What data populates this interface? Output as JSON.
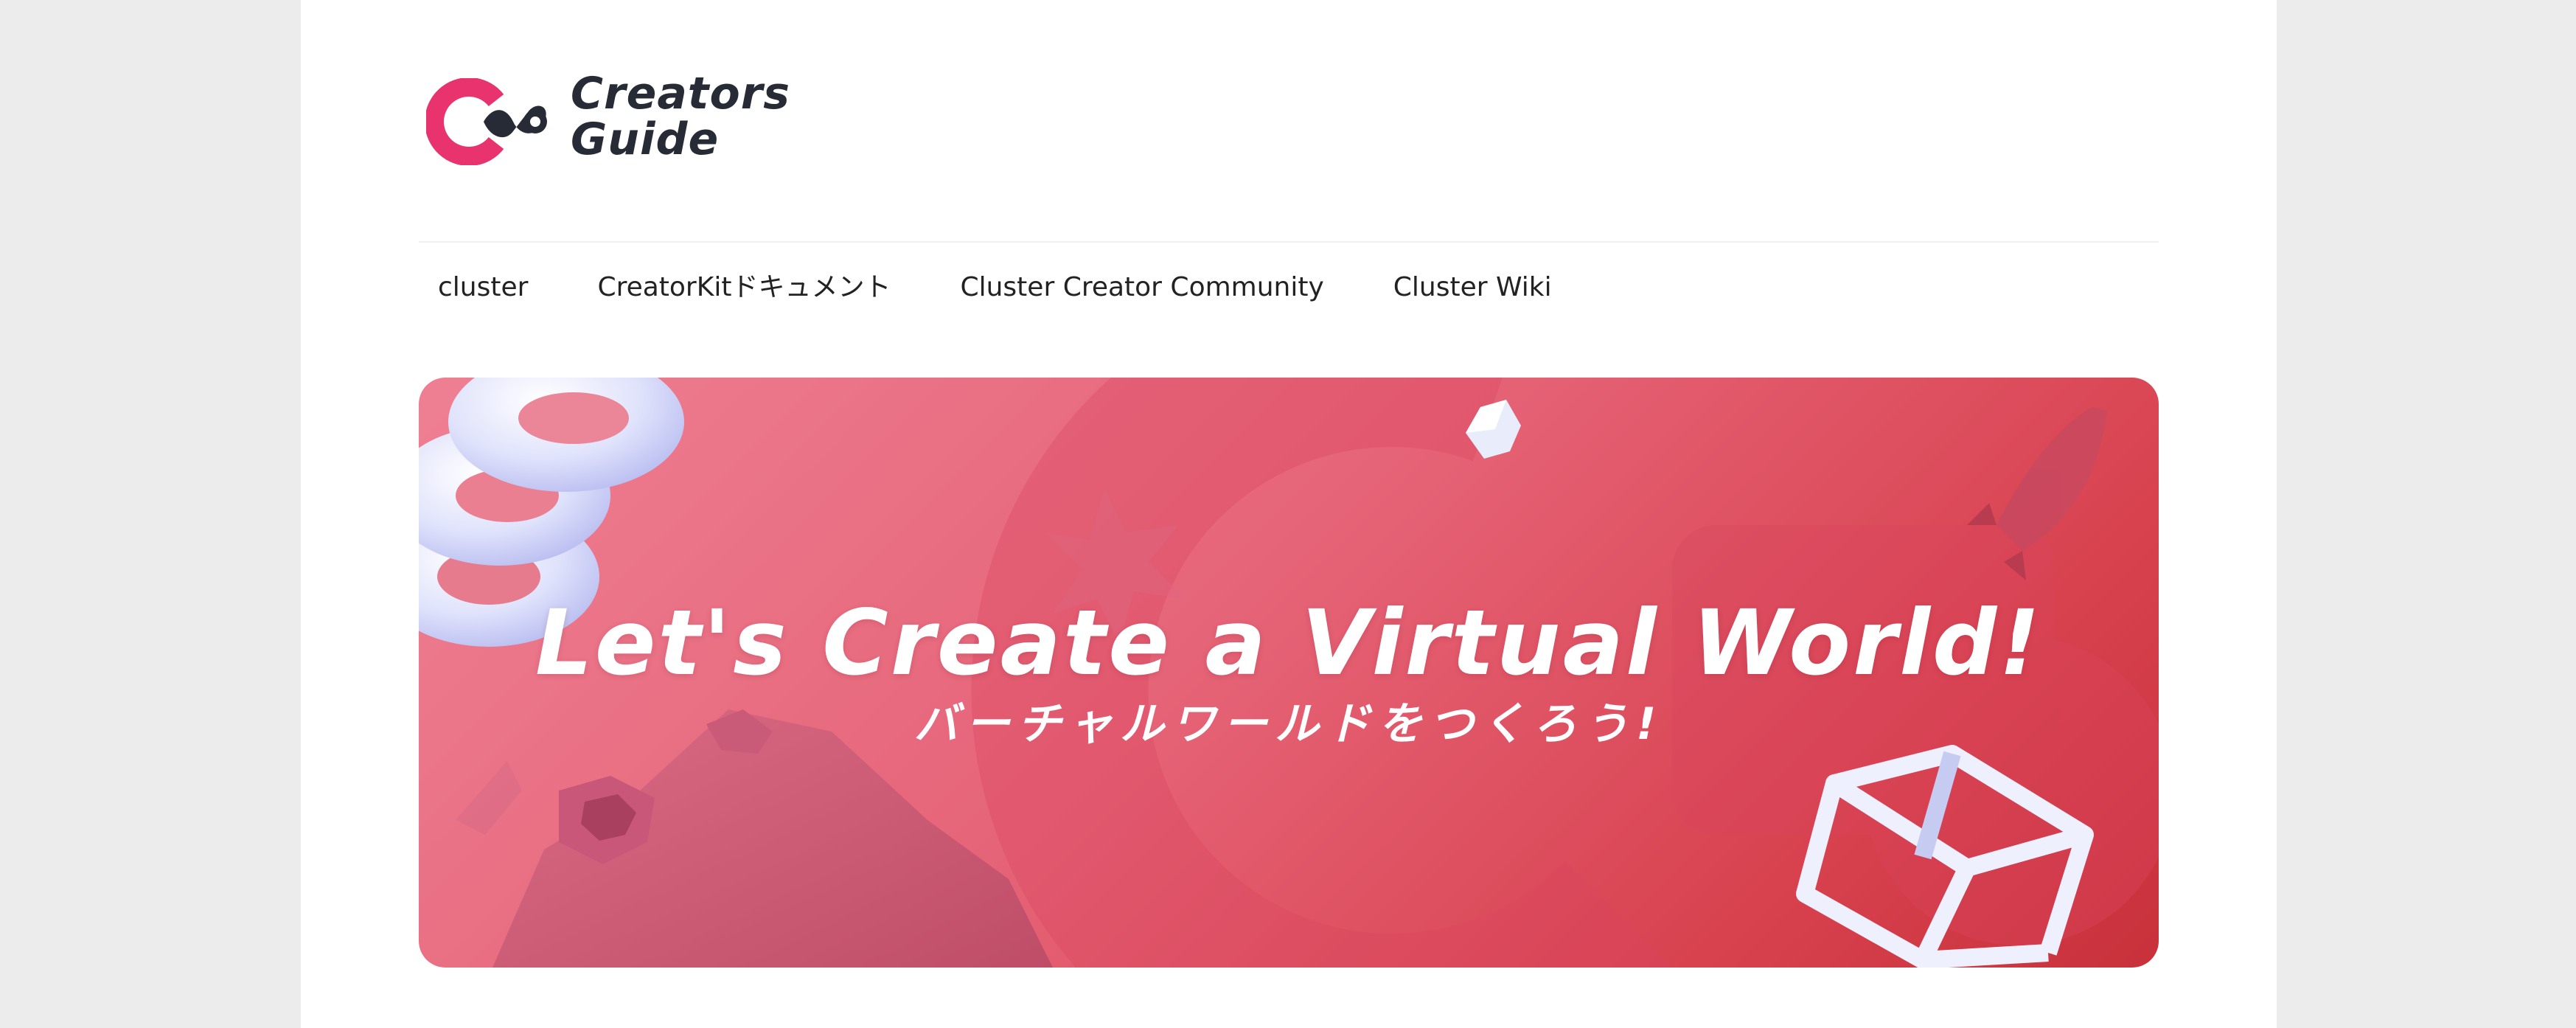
{
  "logo": {
    "line1": "Creators",
    "line2": "Guide",
    "mark_color": "#e8336e",
    "text_color": "#272b36"
  },
  "nav": {
    "items": [
      {
        "label": "cluster"
      },
      {
        "label": "CreatorKitドキュメント"
      },
      {
        "label": "Cluster Creator Community"
      },
      {
        "label": "Cluster Wiki"
      }
    ]
  },
  "hero": {
    "title": "Let's Create a Virtual World!",
    "subtitle": "バーチャルワールドをつくろう!",
    "background_colors": [
      "#ee7f93",
      "#d8424f",
      "#c8313a"
    ]
  },
  "colors": {
    "page_bg": "#ececec",
    "content_bg": "#ffffff",
    "accent": "#e8336e"
  }
}
